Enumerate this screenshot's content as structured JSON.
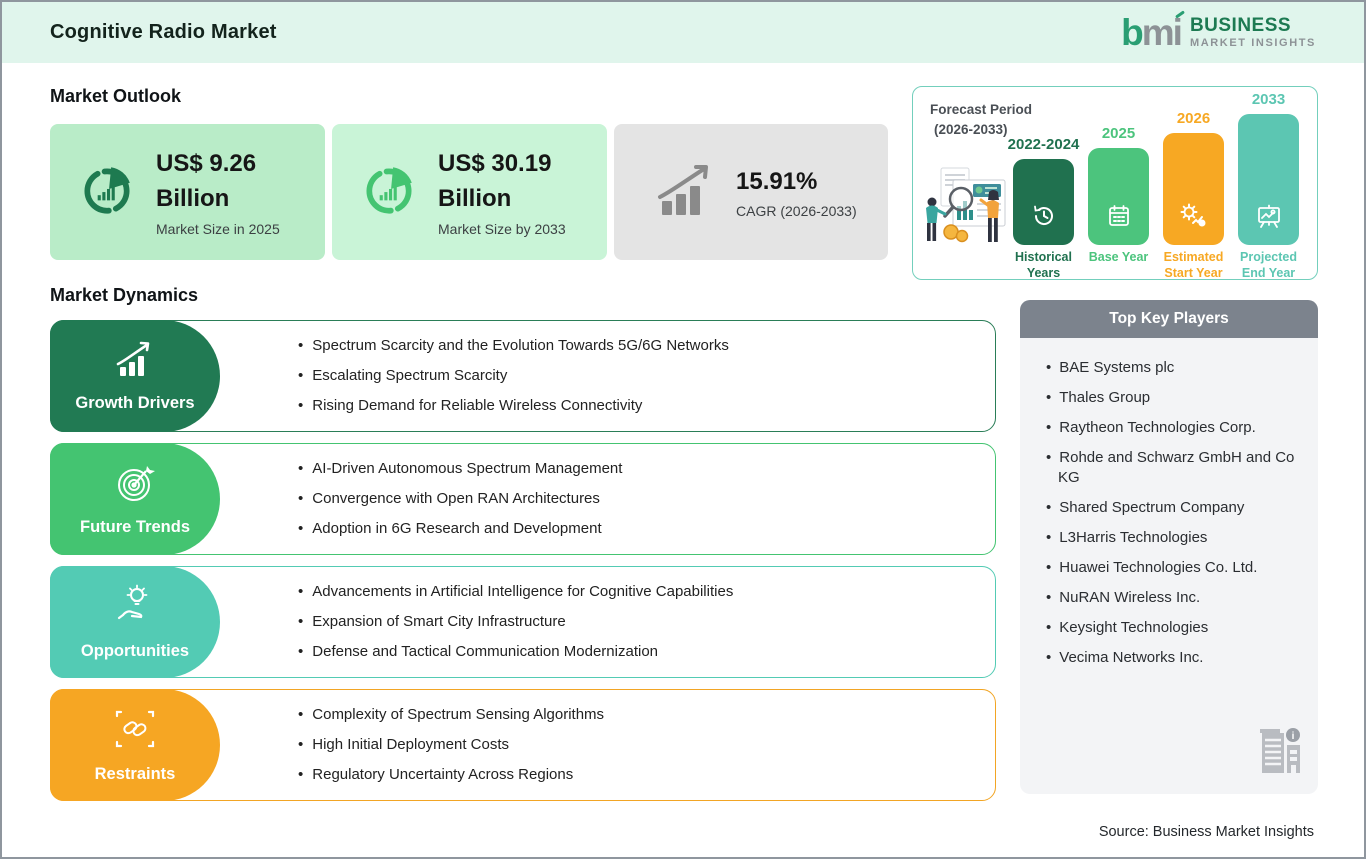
{
  "page": {
    "title": "Cognitive Radio Market",
    "source": "Source: Business Market Insights"
  },
  "logo": {
    "mark": "bmi",
    "line1": "BUSINESS",
    "line2": "MARKET INSIGHTS",
    "green": "#2a9e73",
    "gray": "#8d9296"
  },
  "market_outlook": {
    "heading": "Market Outlook",
    "cards": [
      {
        "icon": "donut-chart-icon",
        "value": "US$ 9.26",
        "unit": "Billion",
        "caption": "Market Size in 2025",
        "bg": "#b9ecc8",
        "icon_color": "#1e7a50"
      },
      {
        "icon": "donut-chart-icon",
        "value": "US$ 30.19",
        "unit": "Billion",
        "caption": "Market Size by 2033",
        "bg": "#c9f4d7",
        "icon_color": "#44c471"
      },
      {
        "icon": "growth-chart-icon",
        "value": "15.91%",
        "unit": "",
        "caption": "CAGR (2026-2033)",
        "bg": "#e4e4e4",
        "icon_color": "#8a8a8a"
      }
    ]
  },
  "forecast": {
    "title_line1": "Forecast Period",
    "title_line2": "(2026-2033)",
    "chart_data": {
      "type": "bar",
      "categories": [
        "2022-2024",
        "2025",
        "2026",
        "2033"
      ],
      "labels": [
        "Historical Years",
        "Base Year",
        "Estimated Start Year",
        "Projected End Year"
      ],
      "relative_heights": [
        86,
        97,
        112,
        131
      ],
      "colors": [
        "#20714f",
        "#4cc47d",
        "#f7a823",
        "#5cc6b2"
      ],
      "icons": [
        "history-clock-icon",
        "calendar-icon",
        "gear-chart-icon",
        "presentation-icon"
      ]
    }
  },
  "market_dynamics": {
    "heading": "Market Dynamics",
    "rows": [
      {
        "label": "Growth Drivers",
        "color": "#217a53",
        "icon": "growth-chart-icon",
        "bullets": [
          "Spectrum Scarcity and the Evolution Towards 5G/6G Networks",
          "Escalating Spectrum Scarcity",
          "Rising Demand for Reliable Wireless Connectivity"
        ]
      },
      {
        "label": "Future Trends",
        "color": "#44c471",
        "icon": "target-icon",
        "bullets": [
          "AI-Driven Autonomous Spectrum Management",
          "Convergence with Open RAN Architectures",
          "Adoption in 6G Research and Development"
        ]
      },
      {
        "label": "Opportunities",
        "color": "#53cbb4",
        "icon": "idea-hand-icon",
        "bullets": [
          "Advancements in Artificial Intelligence for Cognitive Capabilities",
          "Expansion of Smart City Infrastructure",
          "Defense and Tactical Communication Modernization"
        ]
      },
      {
        "label": "Restraints",
        "color": "#f6a623",
        "icon": "chain-icon",
        "bullets": [
          "Complexity of Spectrum Sensing Algorithms",
          "High Initial Deployment Costs",
          "Regulatory Uncertainty Across Regions"
        ]
      }
    ]
  },
  "key_players": {
    "heading": "Top Key Players",
    "header_bg": "#7c838d",
    "items": [
      "BAE Systems plc",
      "Thales Group",
      "Raytheon Technologies Corp.",
      "Rohde and Schwarz GmbH and Co KG",
      "Shared Spectrum Company",
      "L3Harris Technologies",
      "Huawei Technologies Co. Ltd.",
      "NuRAN Wireless Inc.",
      "Keysight Technologies",
      "Vecima Networks Inc."
    ]
  }
}
